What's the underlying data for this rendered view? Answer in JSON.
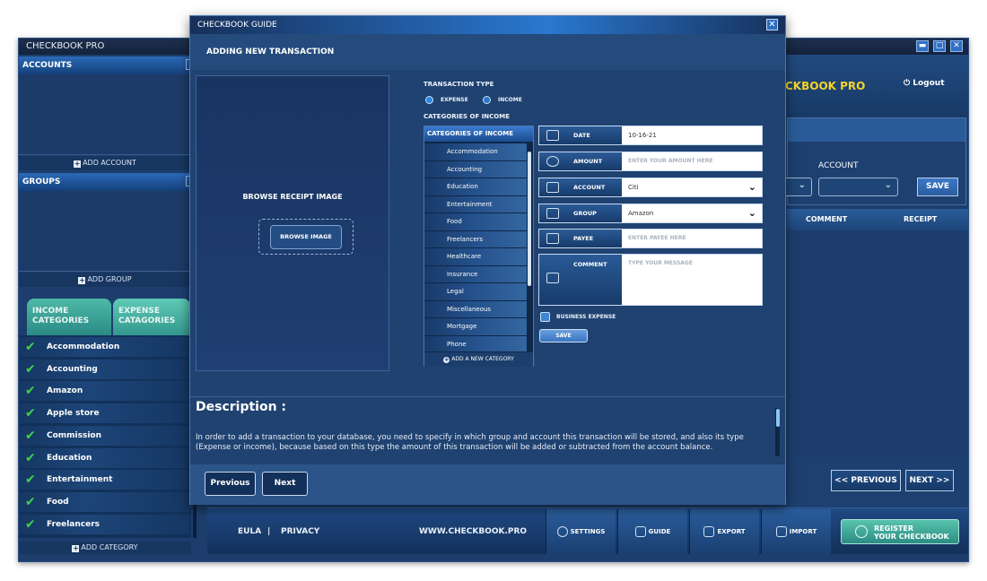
{
  "main_window": {
    "title": "CHECKBOOK PRO",
    "controls": [
      "minimize",
      "maximize",
      "close"
    ]
  },
  "sidebar": {
    "accounts_title": "ACCOUNTS",
    "add_account": "ADD ACCOUNT",
    "groups_title": "GROUPS",
    "add_group": "ADD GROUP",
    "tabs": [
      "INCOME CATEGORIES",
      "EXPENSE CATAGORIES"
    ],
    "categories": [
      "Accommodation",
      "Accounting",
      "Amazon",
      "Apple store",
      "Commission",
      "Education",
      "Entertainment",
      "Food",
      "Freelancers"
    ],
    "add_category": "ADD CATEGORY"
  },
  "right_panel": {
    "brand": "CKBOOK PRO",
    "logout": "Logout",
    "account_label": "ACCOUNT",
    "save": "SAVE",
    "col_comment": "COMMENT",
    "col_receipt": "RECEIPT",
    "prev": "<< PREVIOUS",
    "next": "NEXT >>"
  },
  "bottom_bar": {
    "eula": "EULA",
    "sep": "|",
    "privacy": "PRIVACY",
    "website": "WWW.CHECKBOOK.PRO",
    "settings": "SETTINGS",
    "guide": "GUIDE",
    "export": "EXPORT",
    "import": "IMPORT",
    "register_line1": "REGISTER",
    "register_line2": "YOUR CHECKBOOK"
  },
  "dialog": {
    "title": "CHECKBOOK GUIDE",
    "heading": "ADDING NEW TRANSACTION",
    "browse_label": "BROWSE RECEIPT IMAGE",
    "browse_button": "BROWSE IMAGE",
    "transaction_type_label": "TRANSACTION TYPE",
    "type_expense": "EXPENSE",
    "type_income": "INCOME",
    "categories_label": "CATEGORIES OF INCOME",
    "list_header": "CATEGORIES OF INCOME",
    "list_items": [
      "Accommodation",
      "Accounting",
      "Education",
      "Entertainment",
      "Food",
      "Freelancers",
      "Healthcare",
      "Insurance",
      "Legal",
      "Miscellaneous",
      "Mortgage",
      "Phone"
    ],
    "add_new_category": "ADD A NEW CATEGORY",
    "form": {
      "date_label": "DATE",
      "date_value": "10-16-21",
      "amount_label": "AMOUNT",
      "amount_placeholder": "ENTER YOUR AMOUNT HERE",
      "account_label": "ACCOUNT",
      "account_value": "Citi",
      "group_label": "GROUP",
      "group_value": "Amazon",
      "payee_label": "PAYEE",
      "payee_placeholder": "ENTER PAYEE HERE",
      "comment_label": "COMMENT",
      "comment_placeholder": "TYPE YOUR MESSAGE",
      "business_expense": "BUSINESS EXPENSE",
      "save": "SAVE"
    },
    "description_title": "Description :",
    "description_text": "In order to add a transaction to your database, you need to specify in which group and account this transaction will be stored, and also its type (Expense or income), because based on this type the amount of this transaction will be added or subtracted from the account balance.",
    "previous": "Previous",
    "next": "Next"
  }
}
